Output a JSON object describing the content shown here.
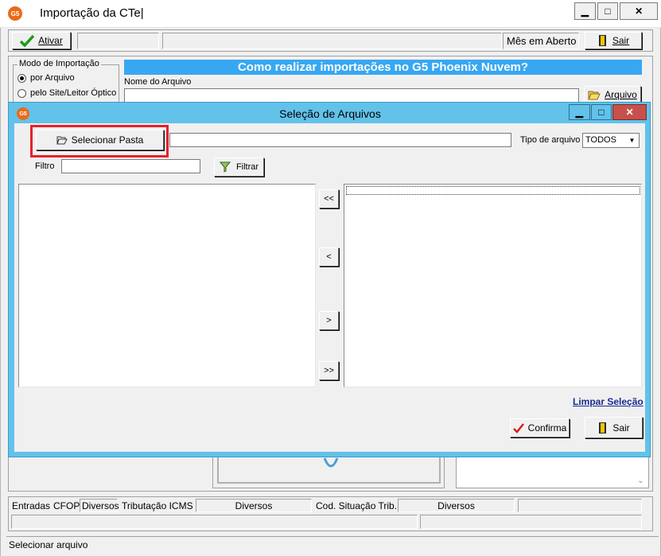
{
  "main_window": {
    "title": "Importação da CTe|",
    "app_icon": "G5",
    "min": "▁",
    "max": "□",
    "close": "✕"
  },
  "toolbar": {
    "ativar_label": "Ativar",
    "mes_label": "Mês em Aberto",
    "sair_label": "Sair"
  },
  "import_mode": {
    "legend": "Modo de Importação",
    "options": [
      "por Arquivo",
      "pelo Site/Leitor Óptico"
    ],
    "selected": "por Arquivo"
  },
  "banner": {
    "text": "Como realizar importações no G5 Phoenix Nuvem?",
    "color": "#38a7f2"
  },
  "file": {
    "label": "Nome do Arquivo",
    "value": "",
    "button_label": "Arquivo"
  },
  "dialog": {
    "title": "Seleção de Arquivos",
    "app_icon": "G5",
    "selecionar_pasta_label": "Selecionar Pasta",
    "path_value": "",
    "tipo_label": "Tipo de arquivo",
    "tipo_value": "TODOS",
    "filtro_label": "Filtro",
    "filtro_value": "",
    "filtrar_label": "Filtrar",
    "move_all_left": "<<",
    "move_left": "<",
    "move_right": ">",
    "move_all_right": ">>",
    "limpar_label": "Limpar Seleção",
    "confirma_label": "Confirma",
    "sair_label": "Sair",
    "highlight_color": "#e8202a",
    "titlebar_color": "#62c2ea"
  },
  "bottom": {
    "entradas": "Entradas",
    "cfop": "CFOP",
    "cfop_value": "Diversos",
    "tributacao": "Tributação ICMS",
    "tributacao_value": "Diversos",
    "cod_sit": "Cod. Situação Trib.",
    "cod_sit_value": "Diversos"
  },
  "status": {
    "text": "Selecionar arquivo"
  }
}
